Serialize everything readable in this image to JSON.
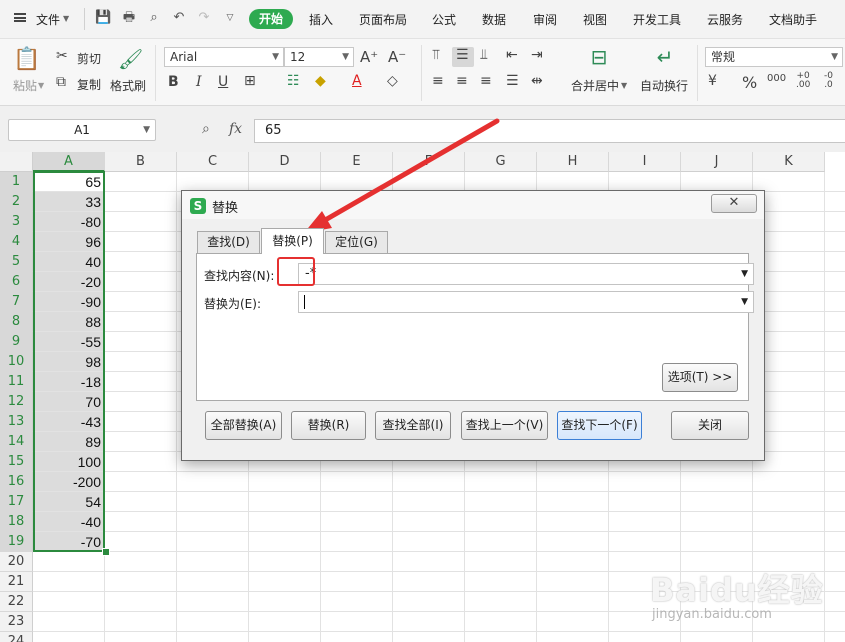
{
  "menubar": {
    "file": "文件",
    "tabs": [
      "开始",
      "插入",
      "页面布局",
      "公式",
      "数据",
      "审阅",
      "视图",
      "开发工具",
      "云服务",
      "文档助手"
    ],
    "active_tab": "开始",
    "accent": "#2eaa50"
  },
  "ribbon": {
    "paste": "粘贴",
    "cut": "剪切",
    "copy": "复制",
    "format_painter": "格式刷",
    "font_name": "Arial",
    "font_size": "12",
    "merge_center": "合并居中",
    "wrap_text": "自动换行",
    "number_format": "常规"
  },
  "formula_bar": {
    "cell_ref": "A1",
    "fx": "fx",
    "value": "65"
  },
  "grid": {
    "columns": [
      "A",
      "B",
      "C",
      "D",
      "E",
      "F",
      "G",
      "H",
      "I",
      "J",
      "K"
    ],
    "rows": [
      "1",
      "2",
      "3",
      "4",
      "5",
      "6",
      "7",
      "8",
      "9",
      "10",
      "11",
      "12",
      "13",
      "14",
      "15",
      "16",
      "17",
      "18",
      "19",
      "20",
      "21",
      "22",
      "23",
      "24"
    ],
    "column_a_values": [
      "65",
      "33",
      "-80",
      "96",
      "40",
      "-20",
      "-90",
      "88",
      "-55",
      "98",
      "-18",
      "70",
      "-43",
      "89",
      "100",
      "-200",
      "54",
      "-40",
      "-70"
    ],
    "selection_color": "#2b8a3e"
  },
  "dialog": {
    "title": "替换",
    "tabs": [
      "查找(D)",
      "替换(P)",
      "定位(G)"
    ],
    "active_tab": "替换(P)",
    "find_label": "查找内容(N):",
    "find_value": "-*",
    "replace_label": "替换为(E):",
    "replace_value": "",
    "options_button": "选项(T) >>",
    "buttons": [
      "全部替换(A)",
      "替换(R)",
      "查找全部(I)",
      "查找上一个(V)",
      "查找下一个(F)",
      "关闭"
    ]
  },
  "annotation": {
    "color": "#e53030"
  },
  "watermark": {
    "main": "Baidu经验",
    "sub": "jingyan.baidu.com"
  }
}
